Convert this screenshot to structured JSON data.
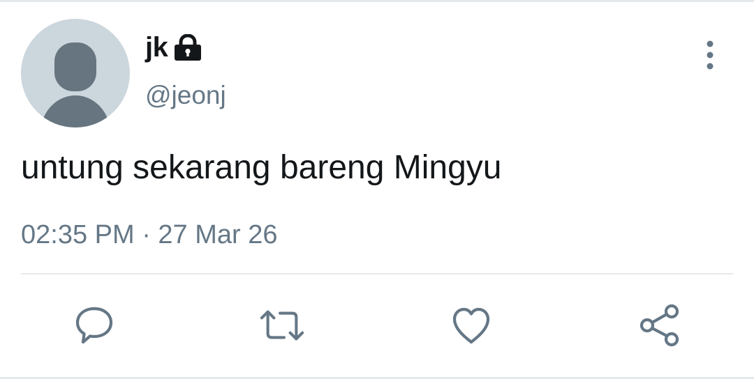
{
  "user": {
    "display_name": "jk",
    "handle": "@jeonj",
    "protected_icon": "lock-icon",
    "avatar_icon": "default-avatar-icon"
  },
  "tweet": {
    "text": "untung sekarang bareng Mingyu",
    "timestamp": "02:35 PM · 27 Mar 26"
  },
  "actions": [
    {
      "name": "reply",
      "icon": "speech-bubble-icon"
    },
    {
      "name": "retweet",
      "icon": "retweet-icon"
    },
    {
      "name": "like",
      "icon": "heart-icon"
    },
    {
      "name": "share",
      "icon": "share-icon"
    }
  ],
  "menu_icon": "more-vertical-icon",
  "colors": {
    "text_primary": "#14171a",
    "text_secondary": "#657786",
    "avatar_bg": "#ccd6dd",
    "avatar_figure": "#66757f",
    "divider": "#e6e9ec"
  }
}
